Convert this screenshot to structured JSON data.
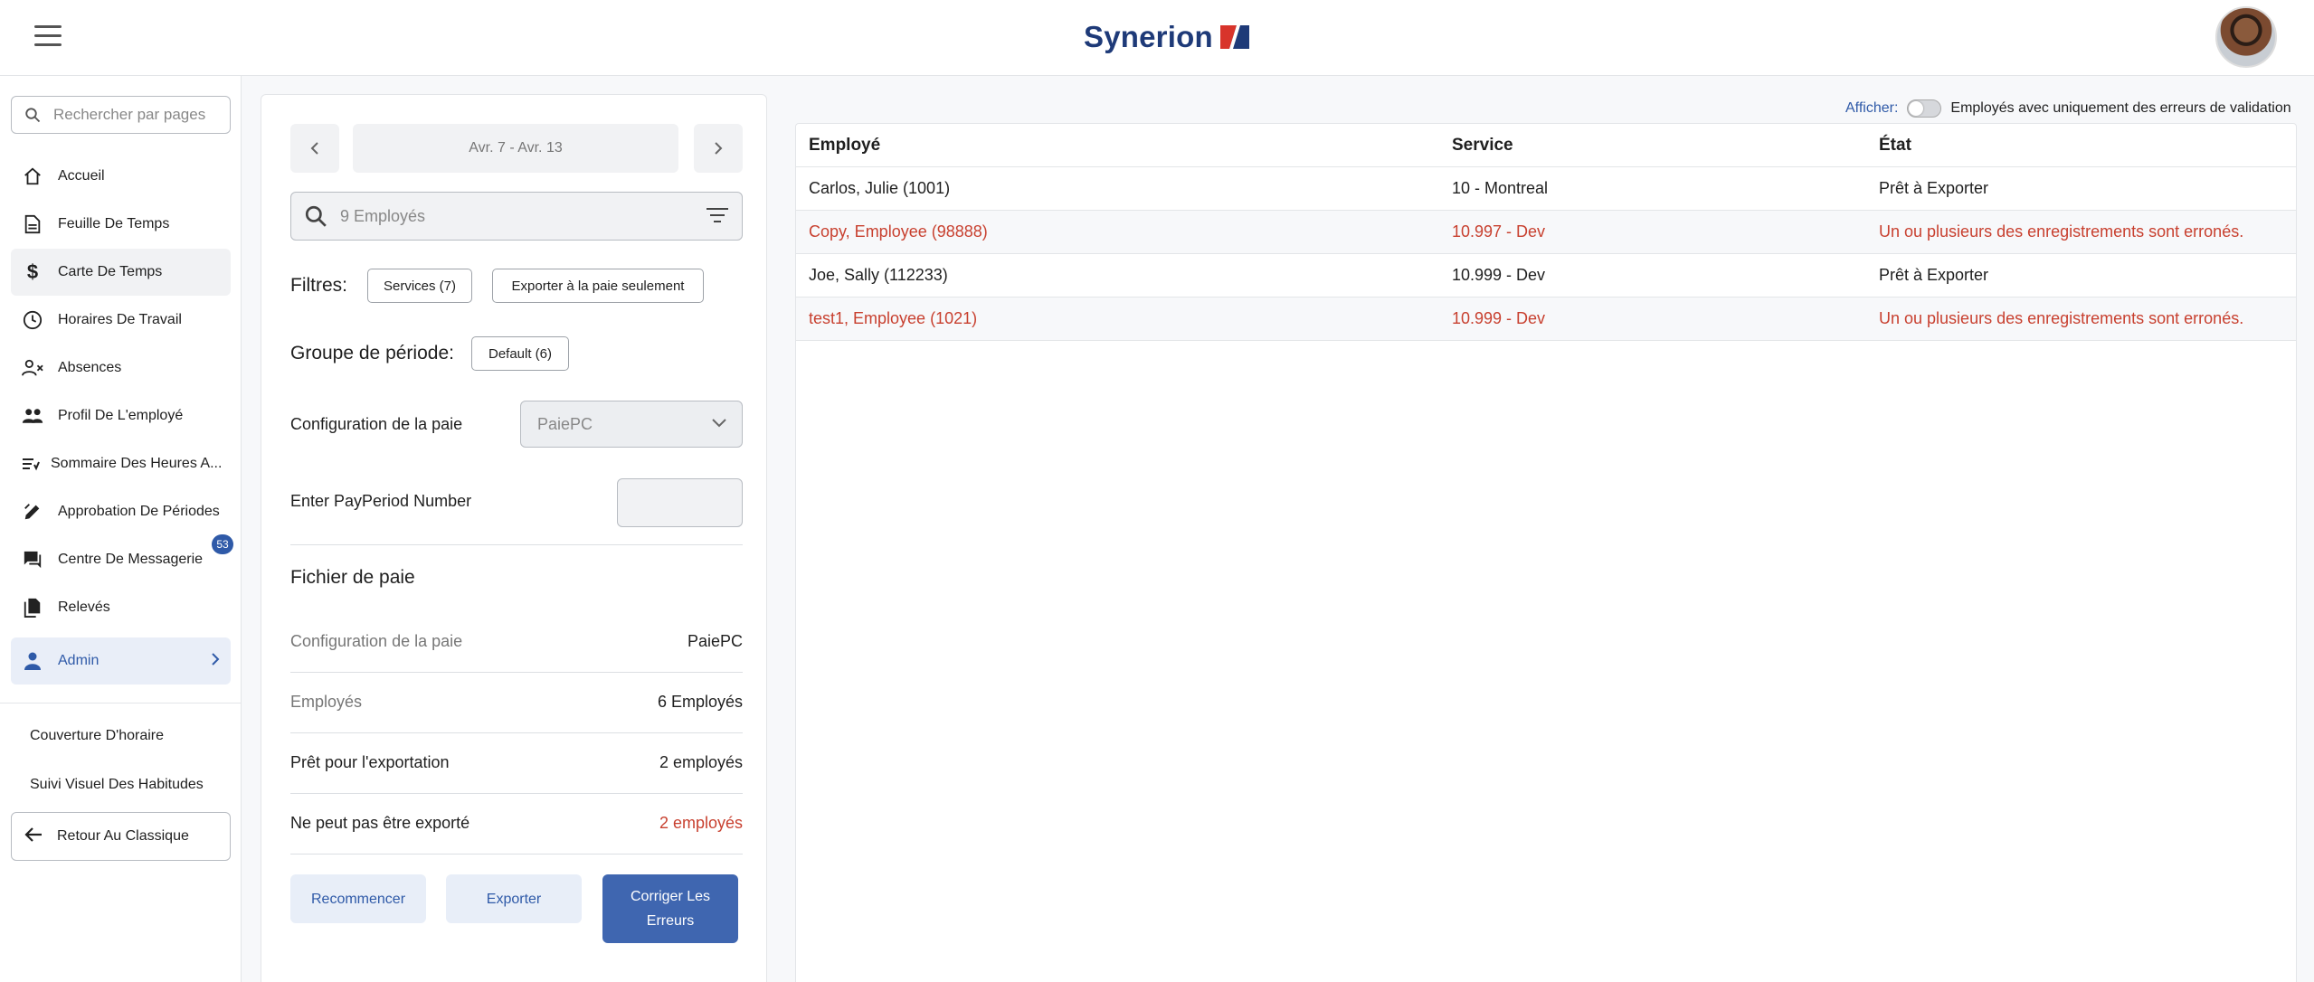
{
  "header": {
    "brand": "Synerion"
  },
  "sidebar": {
    "search_placeholder": "Rechercher par pages",
    "items": [
      {
        "label": "Accueil",
        "icon": "home-icon"
      },
      {
        "label": "Feuille De Temps",
        "icon": "document-icon"
      },
      {
        "label": "Carte De Temps",
        "icon": "dollar-icon"
      },
      {
        "label": "Horaires De Travail",
        "icon": "clock-icon"
      },
      {
        "label": "Absences",
        "icon": "person-remove-icon"
      },
      {
        "label": "Profil De L'employé",
        "icon": "people-icon"
      },
      {
        "label": "Sommaire Des Heures A...",
        "icon": "list-icon"
      },
      {
        "label": "Approbation De Périodes",
        "icon": "edit-icon"
      },
      {
        "label": "Centre De Messagerie",
        "icon": "chat-icon",
        "badge": "53"
      },
      {
        "label": "Relevés",
        "icon": "files-icon"
      },
      {
        "label": "Admin",
        "icon": "person-icon"
      }
    ],
    "sub_items": [
      "Couverture D'horaire",
      "Suivi Visuel Des Habitudes"
    ],
    "back_label": "Retour Au Classique"
  },
  "panel": {
    "period": "Avr. 7 - Avr. 13",
    "employee_search_placeholder": "9 Employés",
    "filters_label": "Filtres:",
    "filter_services": "Services (7)",
    "filter_export": "Exporter à la paie seulement",
    "period_group_label": "Groupe de période:",
    "period_group_value": "Default (6)",
    "pay_config_label": "Configuration de la paie",
    "pay_config_value": "PaiePC",
    "payperiod_label": "Enter PayPeriod Number",
    "payperiod_value": "",
    "pay_file_title": "Fichier de paie",
    "summary": [
      {
        "k": "Configuration de la paie",
        "v": "PaiePC"
      },
      {
        "k": "Employés",
        "v": "6 Employés"
      },
      {
        "k": "Prêt pour l'exportation",
        "v": "2 employés"
      },
      {
        "k": "Ne peut pas être exporté",
        "v": "2 employés"
      }
    ],
    "buttons": {
      "restart": "Recommencer",
      "export": "Exporter",
      "fix": "Corriger Les Erreurs"
    }
  },
  "toggle": {
    "label": "Afficher:",
    "text": "Employés avec uniquement des erreurs de validation",
    "on": false
  },
  "table": {
    "headers": [
      "Employé",
      "Service",
      "État"
    ],
    "rows": [
      {
        "employee": "Carlos, Julie (1001)",
        "service": "10 - Montreal",
        "state": "Prêt à Exporter",
        "error": false
      },
      {
        "employee": "Copy, Employee (98888)",
        "service": "10.997 - Dev",
        "state": "Un ou plusieurs des enregistrements sont erronés.",
        "error": true
      },
      {
        "employee": "Joe, Sally (112233)",
        "service": "10.999 - Dev",
        "state": "Prêt à Exporter",
        "error": false
      },
      {
        "employee": "test1, Employee (1021)",
        "service": "10.999 - Dev",
        "state": "Un ou plusieurs des enregistrements sont erronés.",
        "error": true
      }
    ]
  },
  "colors": {
    "accent": "#3f66b0",
    "error": "#c8402f",
    "brand_navy": "#1e3a78",
    "brand_red": "#d8342b"
  }
}
